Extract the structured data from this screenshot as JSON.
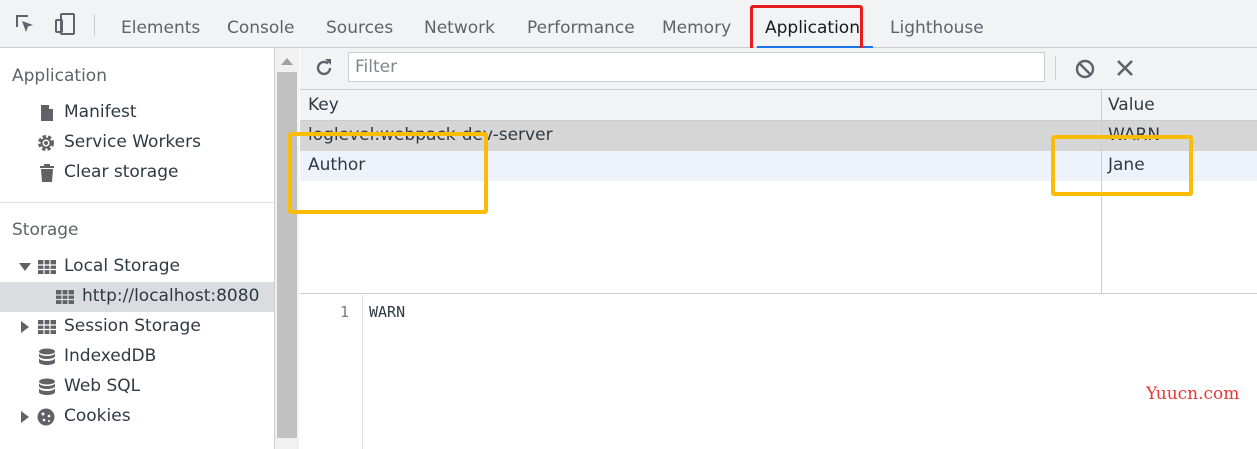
{
  "tabs": [
    "Elements",
    "Console",
    "Sources",
    "Network",
    "Performance",
    "Memory",
    "Application",
    "Lighthouse"
  ],
  "active_tab": "Application",
  "sidebar": {
    "application_heading": "Application",
    "application_items": [
      {
        "label": "Manifest",
        "icon": "file-icon"
      },
      {
        "label": "Service Workers",
        "icon": "gear-icon"
      },
      {
        "label": "Clear storage",
        "icon": "trash-icon"
      }
    ],
    "storage_heading": "Storage",
    "storage_items": [
      {
        "label": "Local Storage",
        "icon": "grid-icon",
        "expanded": true
      },
      {
        "label": "http://localhost:8080",
        "icon": "grid-icon",
        "selected": true
      },
      {
        "label": "Session Storage",
        "icon": "grid-icon",
        "expanded": false
      },
      {
        "label": "IndexedDB",
        "icon": "database-icon"
      },
      {
        "label": "Web SQL",
        "icon": "database-icon"
      },
      {
        "label": "Cookies",
        "icon": "cookie-icon",
        "expanded": false
      }
    ]
  },
  "toolbar": {
    "filter_placeholder": "Filter"
  },
  "table": {
    "headers": [
      "Key",
      "Value"
    ],
    "rows": [
      {
        "key": "loglevel:webpack-dev-server",
        "value": "WARN"
      },
      {
        "key": "Author",
        "value": "Jane"
      }
    ]
  },
  "preview": {
    "line_number": "1",
    "text": "WARN"
  },
  "watermark": "Yuucn.com",
  "colors": {
    "accent": "#1a73e8",
    "highlight_red": "#e81c1c",
    "highlight_yellow": "#fbbc05"
  }
}
